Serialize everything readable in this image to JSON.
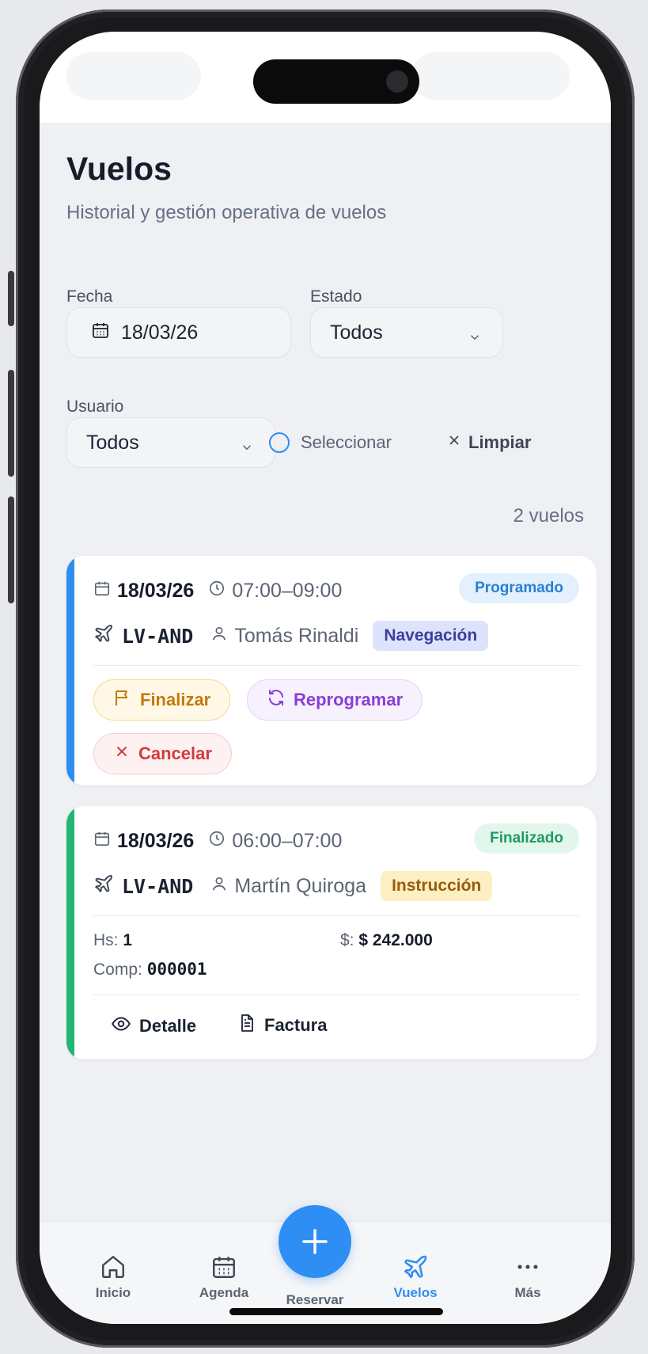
{
  "header": {
    "title": "Vuelos",
    "subtitle": "Historial y gestión operativa de vuelos"
  },
  "filters": {
    "date_label": "Fecha",
    "date_value": "18/03/26",
    "state_label": "Estado",
    "state_value": "Todos",
    "user_label": "Usuario",
    "user_value": "Todos",
    "select_label": "Seleccionar",
    "clear_label": "Limpiar"
  },
  "results_count": "2 vuelos",
  "flights": [
    {
      "date": "18/03/26",
      "time": "07:00–09:00",
      "status": "Programado",
      "plane": "LV-AND",
      "pilot": "Tomás Rinaldi",
      "type": "Navegación",
      "actions": {
        "finish": "Finalizar",
        "reschedule": "Reprogramar",
        "cancel": "Cancelar"
      },
      "colors": {
        "bar": "#2f8cf0",
        "status_bg": "#e3f0fd",
        "status_fg": "#2a7fd4",
        "tag_bg": "#dde3fb",
        "tag_fg": "#3b3f9e"
      }
    },
    {
      "date": "18/03/26",
      "time": "06:00–07:00",
      "status": "Finalizado",
      "plane": "LV-AND",
      "pilot": "Martín Quiroga",
      "type": "Instrucción",
      "hours_label": "Hs:",
      "hours_value": "1",
      "amount_label": "$:",
      "amount_value": "$ 242.000",
      "comp_label": "Comp:",
      "comp_value": "000001",
      "actions": {
        "detail": "Detalle",
        "invoice": "Factura"
      },
      "colors": {
        "bar": "#22b573",
        "status_bg": "#e2f6ec",
        "status_fg": "#1f9a62",
        "tag_bg": "#fcefc2",
        "tag_fg": "#9a5b0b"
      }
    }
  ],
  "tabbar": {
    "home": "Inicio",
    "agenda": "Agenda",
    "book": "Reservar",
    "flights": "Vuelos",
    "more": "Más",
    "active_color": "#2e8ef3"
  }
}
